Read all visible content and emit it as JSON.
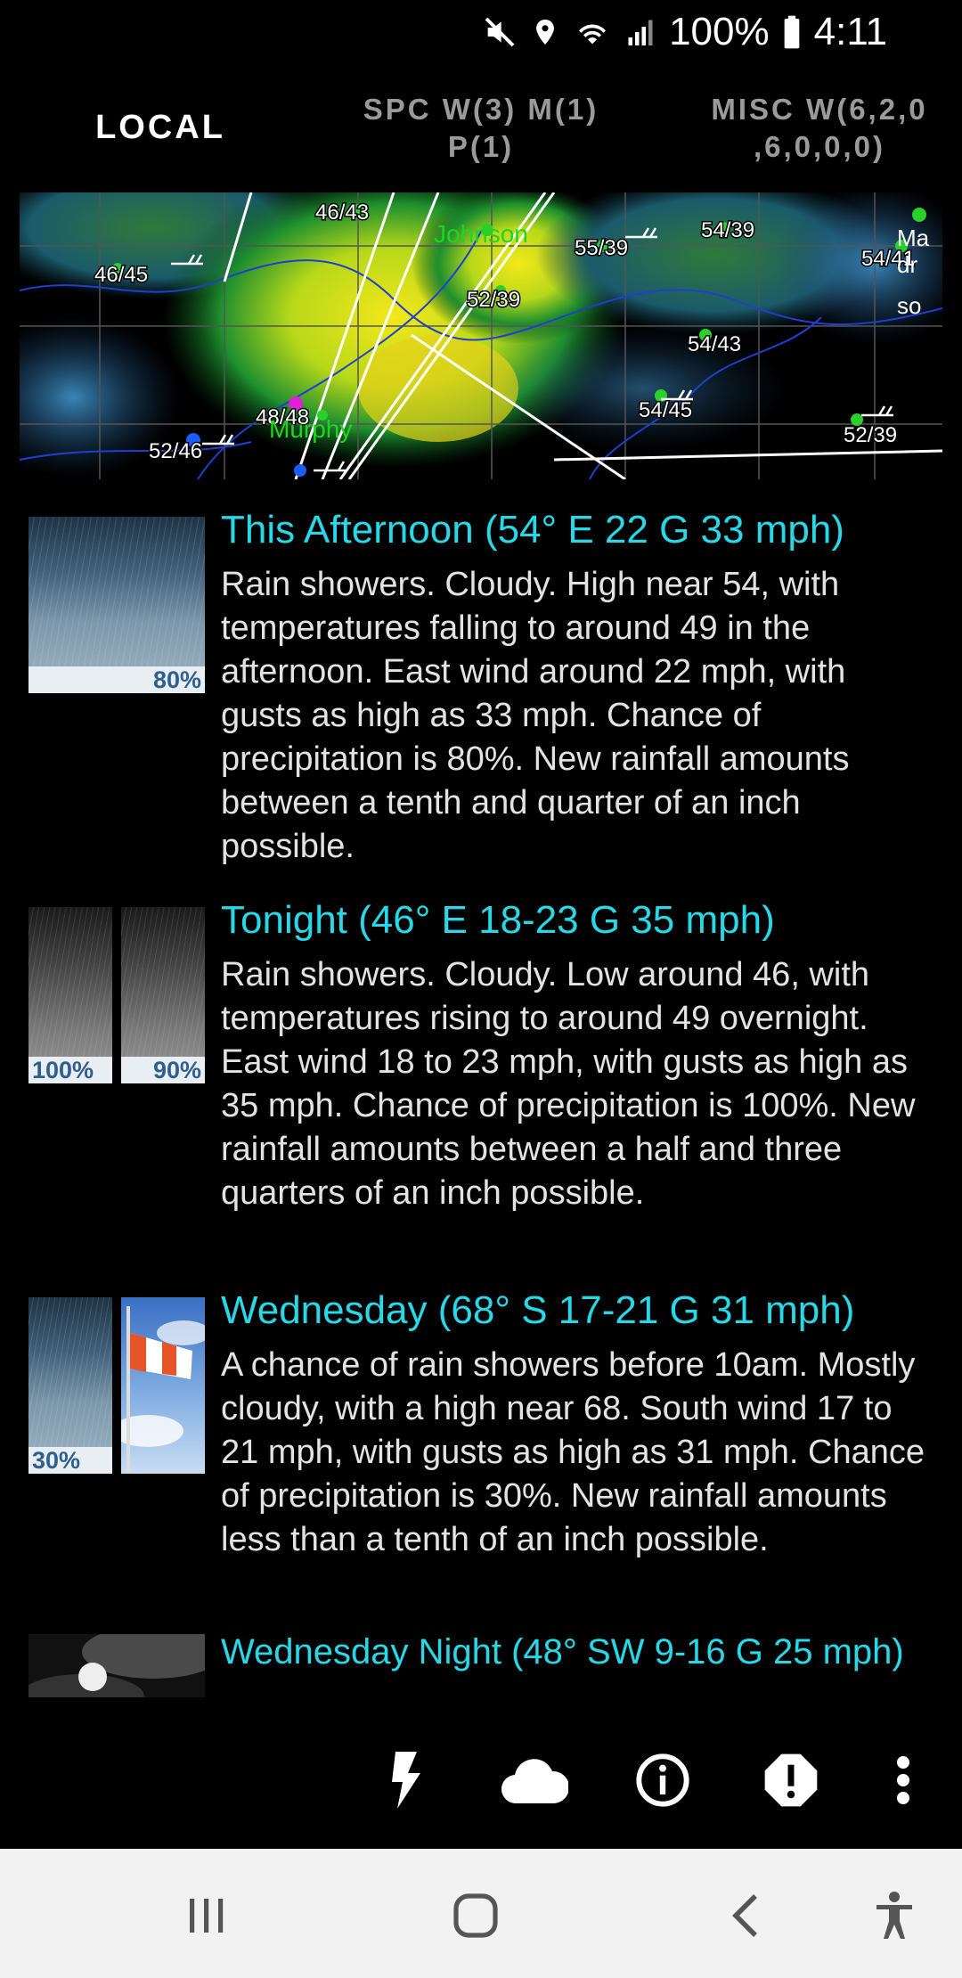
{
  "status": {
    "battery": "100%",
    "time": "4:11"
  },
  "tabs": [
    {
      "label": "LOCAL"
    },
    {
      "label": "SPC W(3) M(1) P(1)"
    },
    {
      "label": "MISC W(6,2,0 ,6,0,0,0)"
    }
  ],
  "radar": {
    "stations": [
      "46/43",
      "55/39",
      "54/39",
      "54/41",
      "46/45",
      "52/39",
      "54/43",
      "48/48",
      "54/45",
      "52/39",
      "52/46"
    ],
    "towns": [
      "Johnson",
      "Murphy",
      "Ma",
      "dr",
      "so"
    ]
  },
  "forecast": [
    {
      "title": "This Afternoon (54° E 22 G 33 mph)",
      "description": "Rain showers. Cloudy. High near 54, with temperatures falling to around 49 in the afternoon. East wind around 22 mph, with gusts as high as 33 mph. Chance of precipitation is 80%. New rainfall amounts between a tenth and quarter of an inch possible.",
      "icons": [
        {
          "name": "rain-showers-icon",
          "pct": "80%"
        }
      ]
    },
    {
      "title": "Tonight (46° E 18-23 G 35 mph)",
      "description": "Rain showers. Cloudy. Low around 46, with temperatures rising to around 49 overnight. East wind 18 to 23 mph, with gusts as high as 35 mph. Chance of precipitation is 100%. New rainfall amounts between a half and three quarters of an inch possible.",
      "icons": [
        {
          "name": "night-rain-icon",
          "pct": "100%"
        },
        {
          "name": "night-rain-icon",
          "pct": "90%"
        }
      ]
    },
    {
      "title": "Wednesday (68° S 17-21 G 31 mph)",
      "description": "A chance of rain showers before 10am. Mostly cloudy, with a high near 68. South wind 17 to 21 mph, with gusts as high as 31 mph. Chance of precipitation is 30%. New rainfall amounts less than a tenth of an inch possible.",
      "icons": [
        {
          "name": "rain-showers-icon",
          "pct": "30%"
        },
        {
          "name": "windsock-icon",
          "pct": ""
        }
      ]
    },
    {
      "title": "Wednesday Night (48° SW 9-16 G 25 mph)",
      "description": "",
      "icons": [
        {
          "name": "night-moon-clouds-icon",
          "pct": ""
        }
      ]
    }
  ],
  "toolbar": [
    "lightning-icon",
    "cloud-icon",
    "info-icon",
    "alert-icon",
    "more-vert-icon"
  ],
  "colors": {
    "title": "#27d9e8",
    "background": "#000000",
    "desc": "#e3e3e3"
  }
}
